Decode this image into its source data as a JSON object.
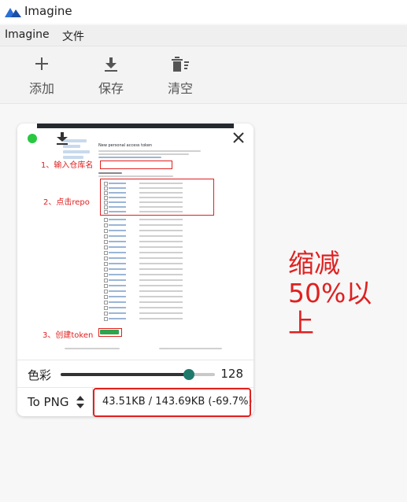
{
  "app": {
    "title": "Imagine"
  },
  "menu": [
    {
      "label": "Imagine"
    },
    {
      "label": "文件"
    }
  ],
  "toolbar": {
    "add_label": "添加",
    "save_label": "保存",
    "clear_label": "清空"
  },
  "card": {
    "preview_annotations": {
      "step1": "1、输入仓库名",
      "step2": "2、点击repo",
      "step3": "3、创建token"
    },
    "doc_title": "New personal access token",
    "color_label": "色彩",
    "color_value": "128",
    "color_level": 0.83,
    "format_label": "To PNG",
    "size_text": "43.51KB / 143.69KB (-69.7%)"
  },
  "note": "缩减50%以上",
  "colors": {
    "accent": "#1f7a6e",
    "annotation_red": "#e02020",
    "status_green": "#28c840"
  },
  "icons": [
    "app-logo-icon",
    "plus-icon",
    "download-icon",
    "trash-icon",
    "close-icon",
    "up-down-icon"
  ]
}
